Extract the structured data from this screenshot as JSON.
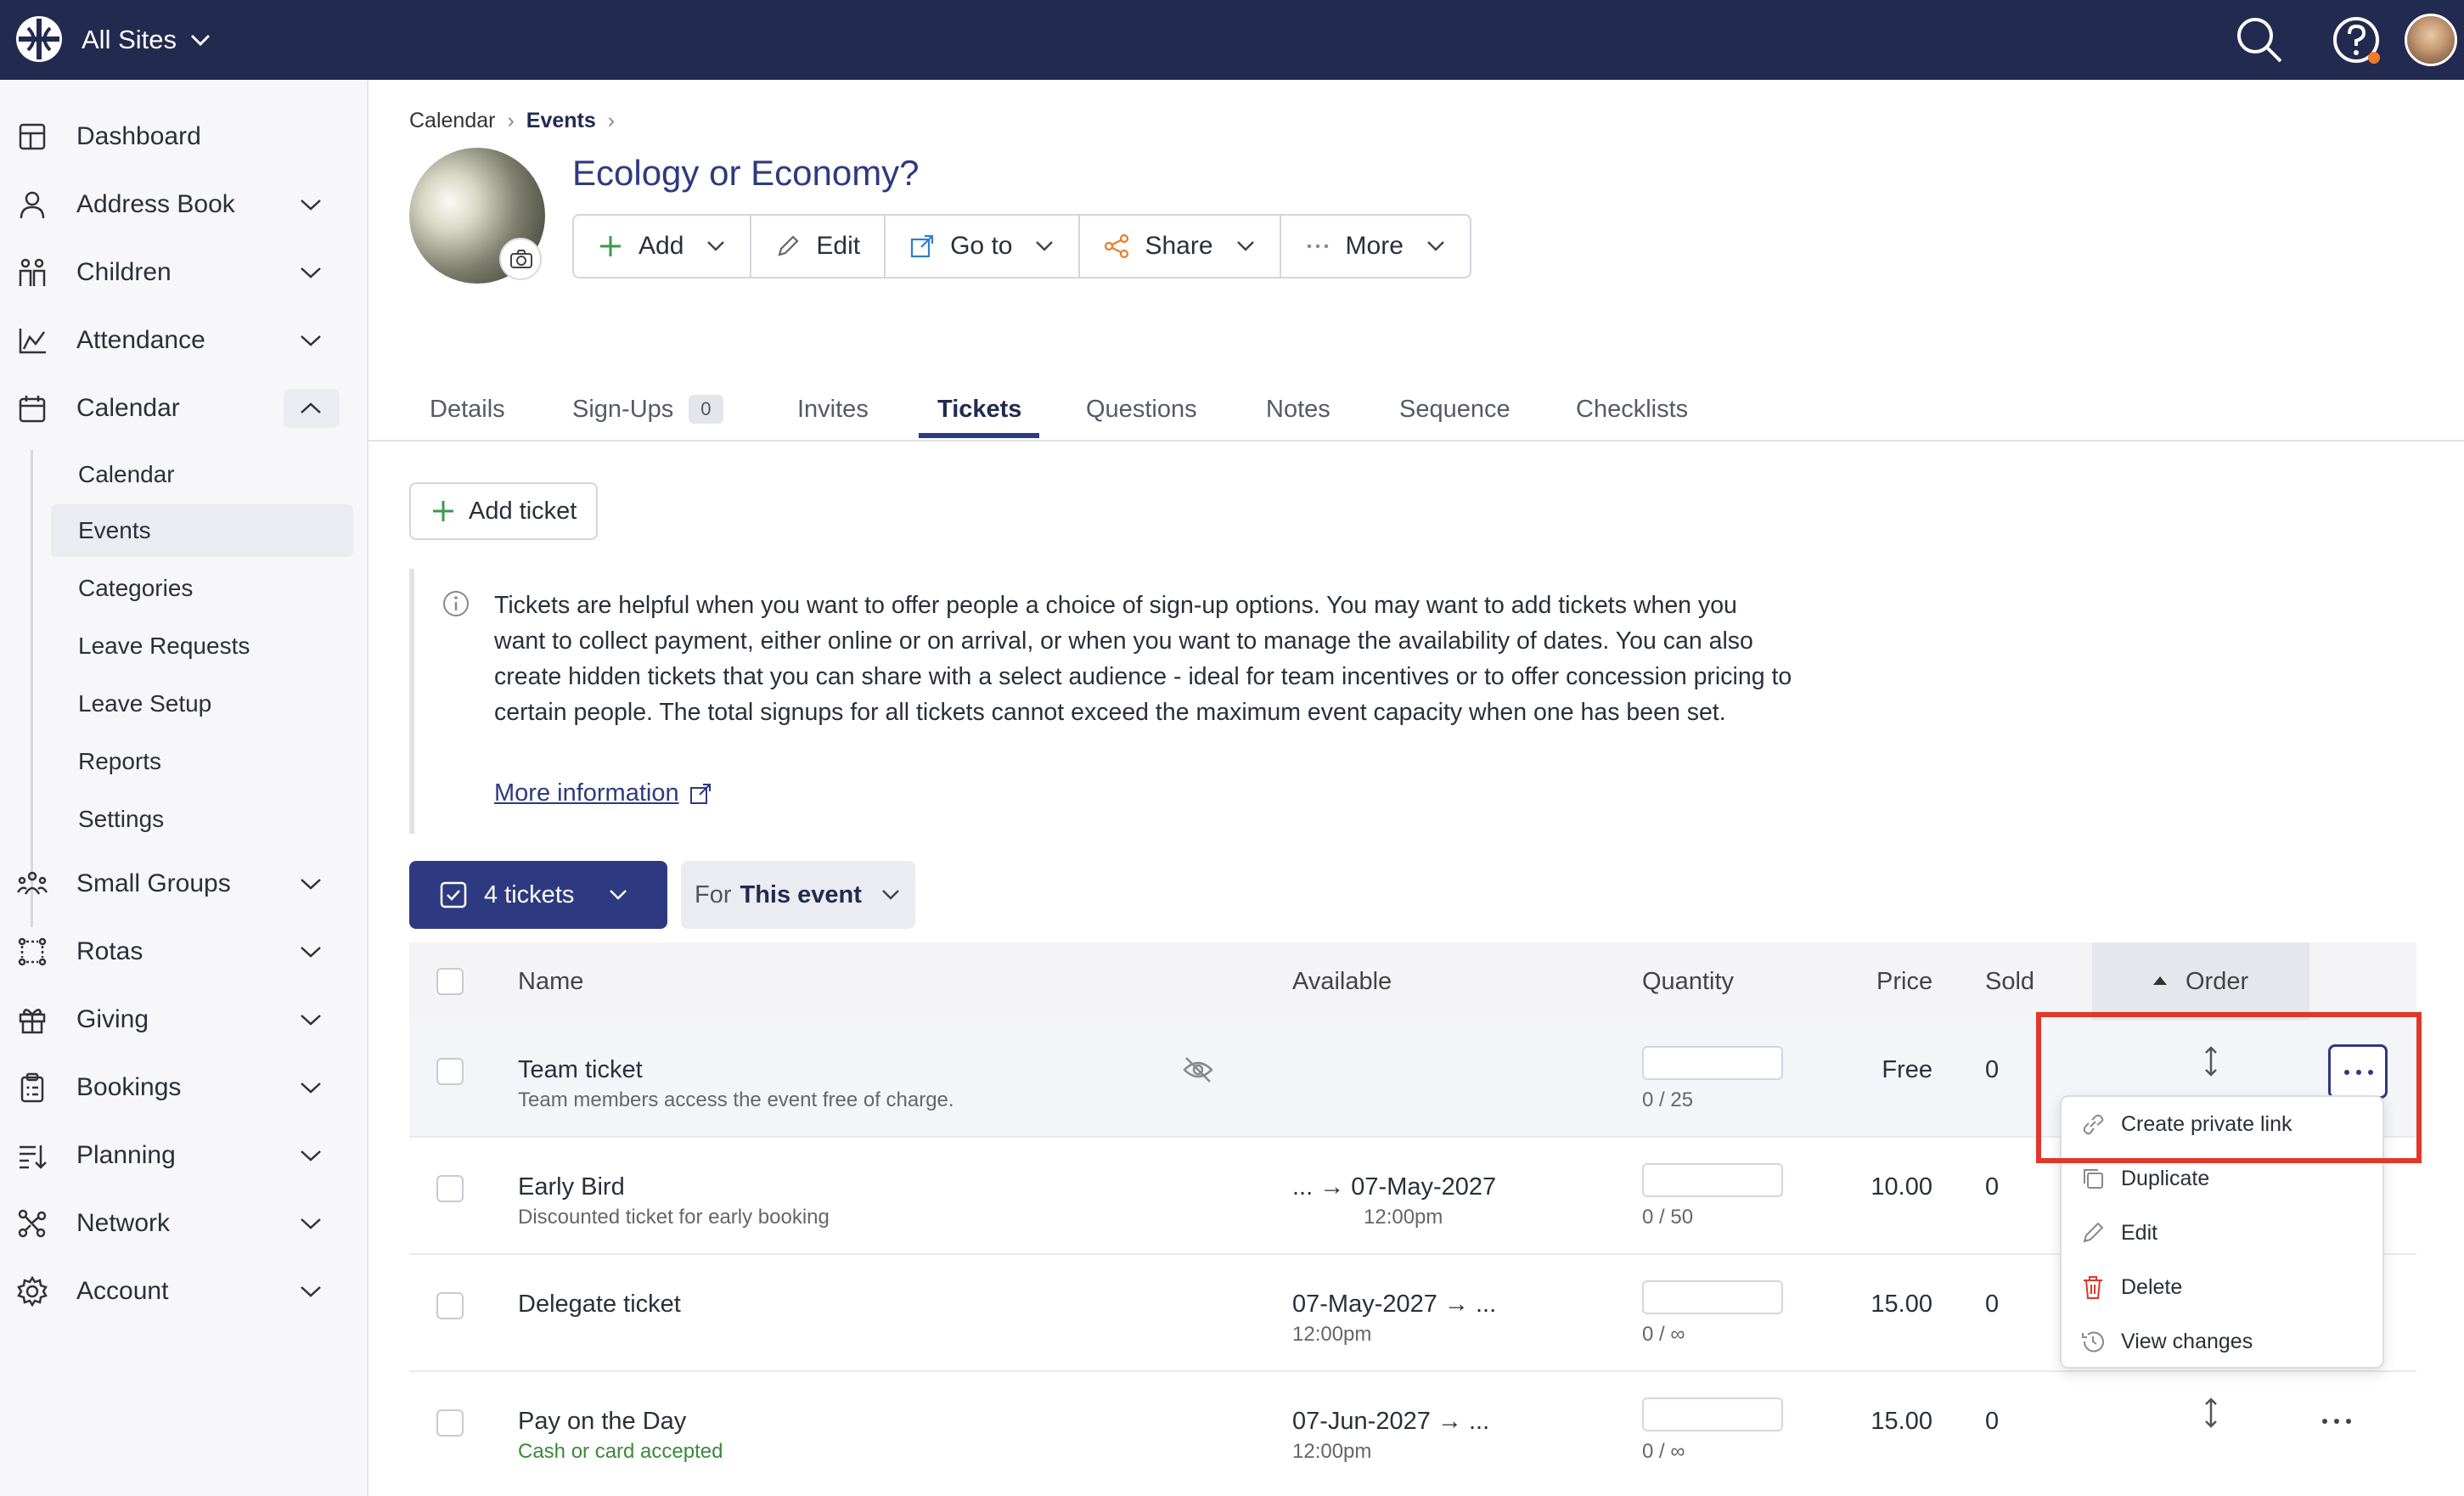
{
  "topbar": {
    "site_label": "All Sites",
    "brand_color": "#232a4f"
  },
  "sidebar": {
    "items": [
      {
        "label": "Dashboard",
        "icon": "dashboard-icon"
      },
      {
        "label": "Address Book",
        "icon": "person-icon"
      },
      {
        "label": "Children",
        "icon": "children-icon"
      },
      {
        "label": "Attendance",
        "icon": "chart-icon"
      },
      {
        "label": "Calendar",
        "icon": "calendar-icon"
      },
      {
        "label": "Small Groups",
        "icon": "groups-icon"
      },
      {
        "label": "Rotas",
        "icon": "rotas-icon"
      },
      {
        "label": "Giving",
        "icon": "gift-icon"
      },
      {
        "label": "Bookings",
        "icon": "clipboard-icon"
      },
      {
        "label": "Planning",
        "icon": "planning-icon"
      },
      {
        "label": "Network",
        "icon": "network-icon"
      },
      {
        "label": "Account",
        "icon": "gear-icon"
      }
    ],
    "calendar_sub": [
      "Calendar",
      "Events",
      "Categories",
      "Leave Requests",
      "Leave Setup",
      "Reports",
      "Settings"
    ]
  },
  "breadcrumb": {
    "first": "Calendar",
    "second": "Events"
  },
  "event": {
    "title": "Ecology or Economy?"
  },
  "toolbar": {
    "add": "Add",
    "edit": "Edit",
    "goto": "Go to",
    "share": "Share",
    "more": "More"
  },
  "tabs": [
    "Details",
    "Sign-Ups",
    "Invites",
    "Tickets",
    "Questions",
    "Notes",
    "Sequence",
    "Checklists"
  ],
  "signups_count": "0",
  "add_ticket_label": "Add ticket",
  "info": {
    "text": "Tickets are helpful when you want to offer people a choice of sign-up options. You may want to add tickets when you want to collect payment, either online or on arrival, or when you want to manage the availability of dates. You can also create hidden tickets that you can share with a select audience - ideal for team incentives or to offer concession pricing to certain people. The total signups for all tickets cannot exceed the maximum event capacity when one has been set.",
    "more_link": "More information"
  },
  "filters": {
    "tickets_label": "4 tickets",
    "for_prefix": "For",
    "for_value": "This event"
  },
  "table": {
    "headers": {
      "name": "Name",
      "available": "Available",
      "quantity": "Quantity",
      "price": "Price",
      "sold": "Sold",
      "order": "Order"
    },
    "rows": [
      {
        "name": "Team ticket",
        "desc": "Team members access the event free of charge.",
        "avail_main": "",
        "avail_time": "",
        "qty": "0 / 25",
        "price": "Free",
        "sold": "0"
      },
      {
        "name": "Early Bird",
        "desc": "Discounted ticket for early booking",
        "avail_main": "...  →  07-May-2027",
        "avail_time": "12:00pm",
        "qty": "0 / 50",
        "price": "10.00",
        "sold": "0"
      },
      {
        "name": "Delegate ticket",
        "desc": "",
        "avail_main": "07-May-2027  →  ...",
        "avail_time": "12:00pm",
        "qty": "0 / ∞",
        "price": "15.00",
        "sold": "0"
      },
      {
        "name": "Pay on the Day",
        "desc": "Cash or card accepted",
        "avail_main": "07-Jun-2027  →  ...",
        "avail_time": "12:00pm",
        "qty": "0 / ∞",
        "price": "15.00",
        "sold": "0"
      }
    ]
  },
  "row_menu": [
    "Create private link",
    "Duplicate",
    "Edit",
    "Delete",
    "View changes"
  ]
}
